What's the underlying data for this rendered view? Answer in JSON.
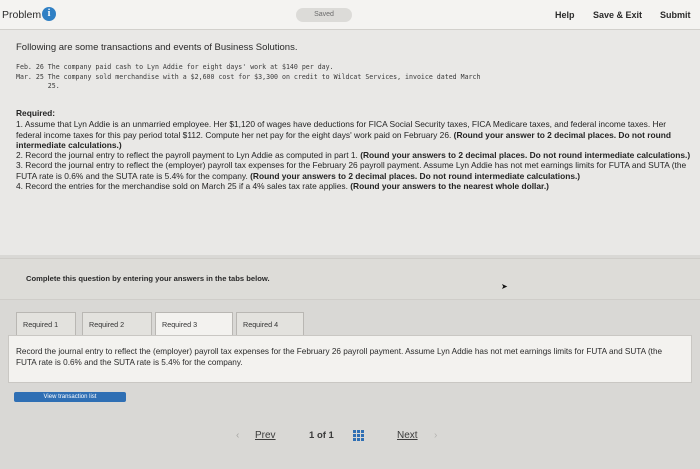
{
  "topbar": {
    "problem_label": "Problem",
    "info_glyph": "i",
    "saved_label": "Saved",
    "help": "Help",
    "save_exit": "Save & Exit",
    "submit": "Submit"
  },
  "intro": "Following are some transactions and events of Business Solutions.",
  "transactions": [
    "Feb. 26 The company paid cash to Lyn Addie for eight days' work at $140 per day.",
    "Mar. 25 The company sold merchandise with a $2,600 cost for $3,300 on credit to Wildcat Services, invoice dated March",
    "        25."
  ],
  "required": {
    "heading": "Required:",
    "items": [
      {
        "text": "1. Assume that Lyn Addie is an unmarried employee. Her $1,120 of wages have deductions for FICA Social Security taxes, FICA Medicare taxes, and federal income taxes. Her federal income taxes for this pay period total $112. Compute her net pay for the eight days' work paid on February 26. ",
        "bold": "(Round your answer to 2 decimal places. Do not round intermediate calculations.)"
      },
      {
        "text": "2. Record the journal entry to reflect the payroll payment to Lyn Addie as computed in part 1. ",
        "bold": "(Round your answers to 2 decimal places. Do not round intermediate calculations.)"
      },
      {
        "text": "3. Record the journal entry to reflect the (employer) payroll tax expenses for the February 26 payroll payment. Assume Lyn Addie has not met earnings limits for FUTA and SUTA (the FUTA rate is 0.6% and the SUTA rate is 5.4% for the company. ",
        "bold": "(Round your answers to 2 decimal places. Do not round intermediate calculations.)"
      },
      {
        "text": "4. Record the entries for the merchandise sold on March 25 if a 4% sales tax rate applies. ",
        "bold": "(Round your answers to the nearest whole dollar.)"
      }
    ]
  },
  "complete_prompt": "Complete this question by entering your answers in the tabs below.",
  "tabs": [
    {
      "label": "Required 1"
    },
    {
      "label": "Required 2"
    },
    {
      "label": "Required 3"
    },
    {
      "label": "Required 4"
    }
  ],
  "active_tab": "Required 3",
  "tab_content": "Record the journal entry to reflect the (employer) payroll tax expenses for the February 26 payroll payment. Assume Lyn Addie has not met earnings limits for FUTA and SUTA (the FUTA rate is 0.6% and the SUTA rate is 5.4% for the company.",
  "view_button": "View transaction list",
  "pager": {
    "prev_glyph": "‹",
    "prev": "Prev",
    "current": "1",
    "of_label": "of",
    "total": "1",
    "next": "Next",
    "next_glyph": "›"
  },
  "colors": {
    "accent": "#2f6fb4",
    "info": "#2f7fc4"
  }
}
